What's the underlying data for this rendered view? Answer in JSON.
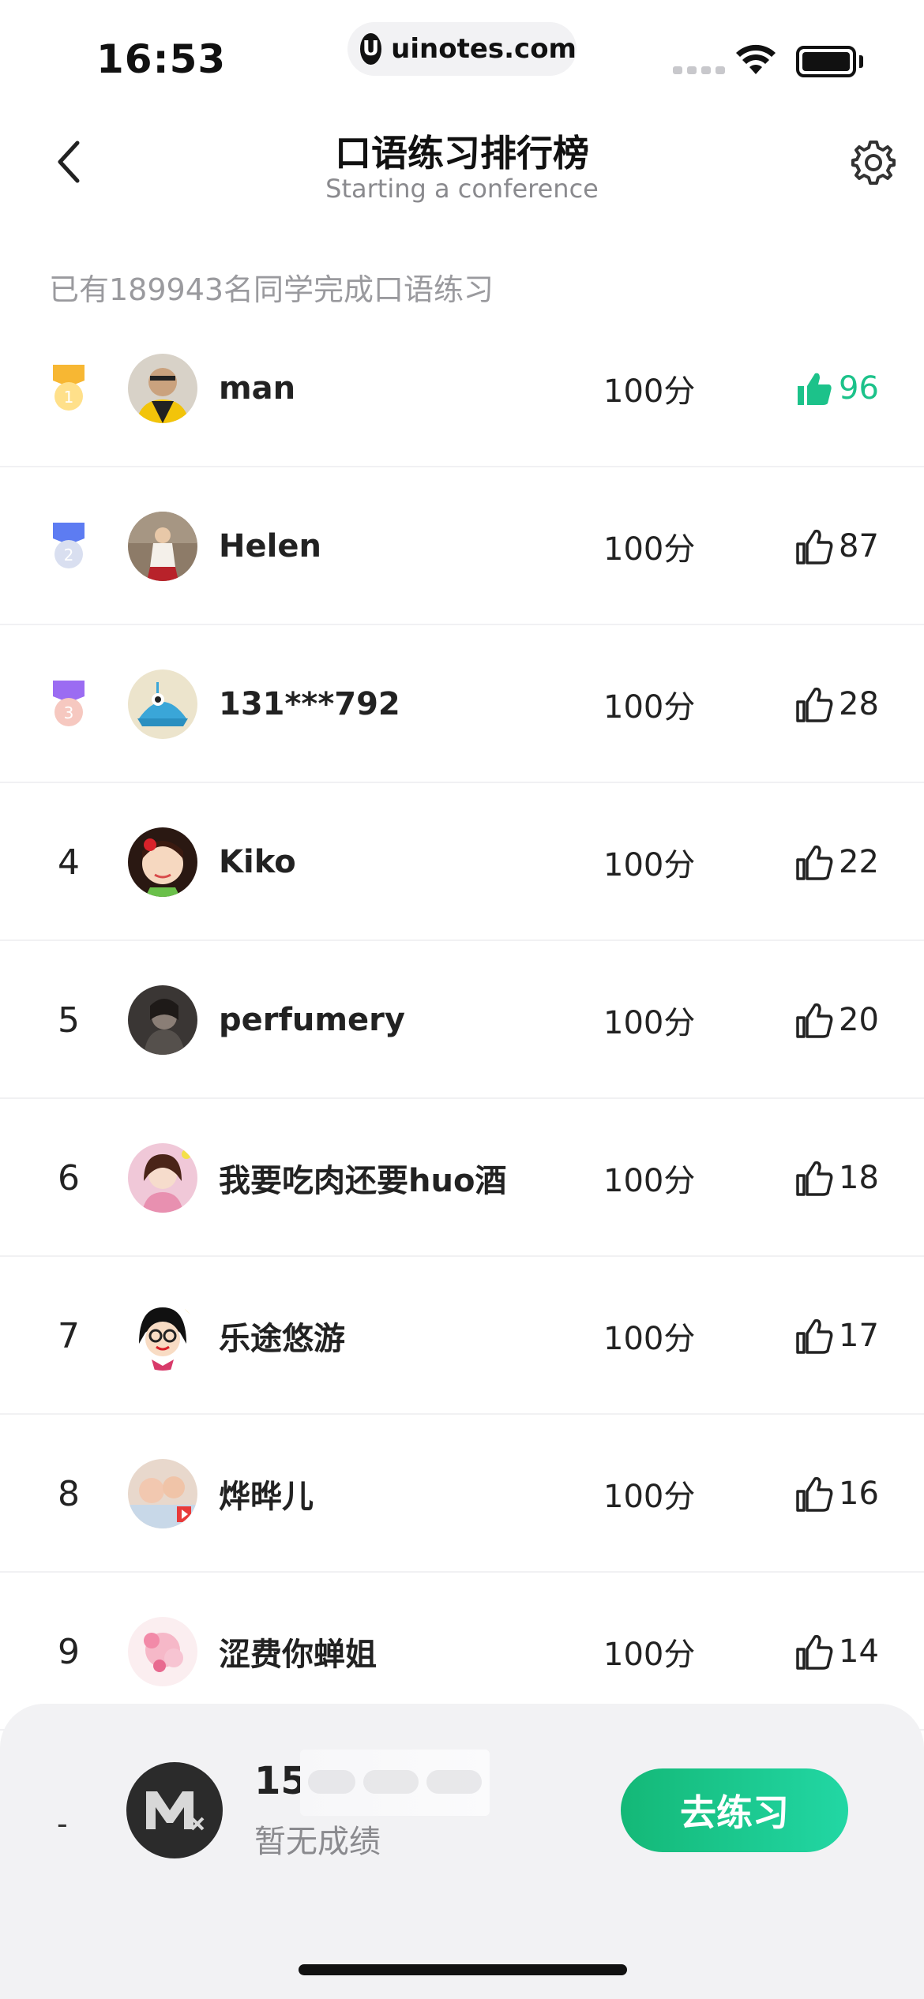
{
  "status_bar": {
    "time": "16:53",
    "url": "uinotes.com",
    "url_logo": "U"
  },
  "header": {
    "title": "口语练习排行榜",
    "subtitle": "Starting a conference"
  },
  "summary": "已有189943名同学完成口语练习",
  "rows": [
    {
      "rank": "1",
      "name": "man",
      "score": "100分",
      "likes": "96",
      "liked": true
    },
    {
      "rank": "2",
      "name": "Helen",
      "score": "100分",
      "likes": "87"
    },
    {
      "rank": "3",
      "name": "131***792",
      "score": "100分",
      "likes": "28"
    },
    {
      "rank": "4",
      "name": "Kiko",
      "score": "100分",
      "likes": "22"
    },
    {
      "rank": "5",
      "name": "perfumery",
      "score": "100分",
      "likes": "20"
    },
    {
      "rank": "6",
      "name": "我要吃肉还要huo酒",
      "score": "100分",
      "likes": "18"
    },
    {
      "rank": "7",
      "name": "乐途悠游",
      "score": "100分",
      "likes": "17"
    },
    {
      "rank": "8",
      "name": "烨晔儿",
      "score": "100分",
      "likes": "16"
    },
    {
      "rank": "9",
      "name": "涩费你蝉姐",
      "score": "100分",
      "likes": "14"
    }
  ],
  "me": {
    "rank": "-",
    "name": "15",
    "status": "暂无成绩",
    "action": "去练习"
  },
  "colors": {
    "accent": "#1cc28a",
    "gold": "#f7b733",
    "silver": "#5d7cf2",
    "bronze": "#9b6cf2"
  },
  "icons": [
    "back-icon",
    "gear-icon",
    "thumbs-up-icon",
    "medal-icon"
  ]
}
